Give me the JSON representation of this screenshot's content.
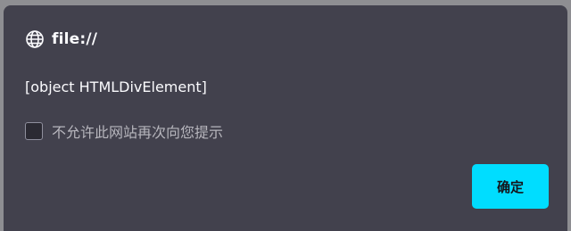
{
  "dialog": {
    "title": "file://",
    "title_icon": "globe-icon",
    "message": "[object HTMLDivElement]",
    "checkbox": {
      "label": "不允许此网站再次向您提示",
      "checked": false
    },
    "ok_button_label": "确定"
  },
  "colors": {
    "dialog_background": "#42414d",
    "backdrop": "#8e8e92",
    "accent": "#00ddff",
    "text_primary": "#fbfbfe",
    "text_secondary": "#b7b6bd"
  }
}
